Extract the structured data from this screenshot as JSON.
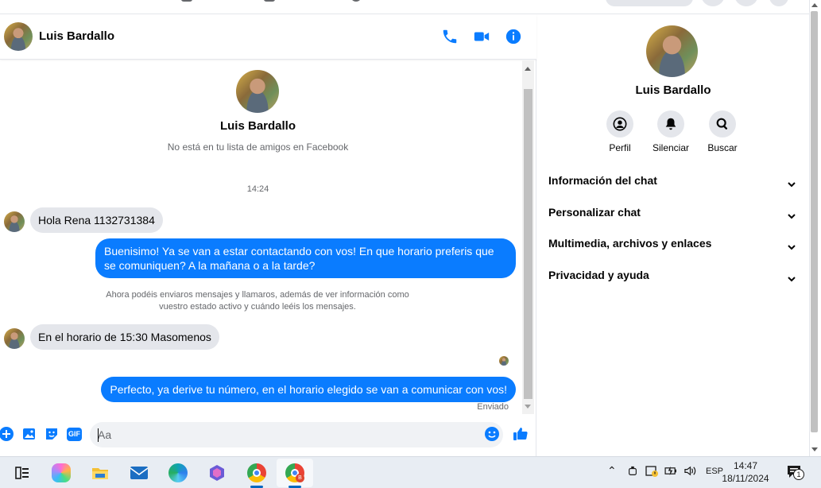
{
  "contact": {
    "name": "Luis Bardallo",
    "not_friend_notice": "No está en tu lista de amigos en Facebook"
  },
  "header": {
    "icons": [
      "phone-icon",
      "video-icon",
      "info-icon"
    ]
  },
  "conversation": {
    "timestamp": "14:24",
    "messages": [
      {
        "direction": "in",
        "text": "Hola Rena 1132731384"
      },
      {
        "direction": "out",
        "text": "Buenisimo! Ya se van a estar contactando con vos! En que horario preferis que se comuniquen? A la mañana o a la tarde?"
      },
      {
        "direction": "system",
        "text": "Ahora podéis enviaros mensajes y llamaros, además de ver información como vuestro estado activo y cuándo leéis los mensajes."
      },
      {
        "direction": "in",
        "text": "En el horario de 15:30 Masomenos"
      },
      {
        "direction": "out",
        "text": "Perfecto, ya derive tu número,  en el horario elegido se van a comunicar con vos!"
      }
    ],
    "status": "Enviado"
  },
  "composer": {
    "placeholder": "Aa",
    "gif_label": "GIF"
  },
  "info_panel": {
    "name": "Luis Bardallo",
    "actions": [
      {
        "label": "Perfil",
        "icon": "profile-icon"
      },
      {
        "label": "Silenciar",
        "icon": "bell-icon"
      },
      {
        "label": "Buscar",
        "icon": "search-icon"
      }
    ],
    "sections": [
      {
        "label": "Información del chat"
      },
      {
        "label": "Personalizar chat"
      },
      {
        "label": "Multimedia, archivos y enlaces"
      },
      {
        "label": "Privacidad y ayuda"
      }
    ]
  },
  "taskbar": {
    "language": "ESP",
    "time": "14:47",
    "date": "18/11/2024",
    "notification_count": "1",
    "chrome_badge": "B"
  },
  "colors": {
    "accent": "#0a7cff",
    "bubble_in": "#e4e6eb",
    "muted_text": "#65676b"
  }
}
